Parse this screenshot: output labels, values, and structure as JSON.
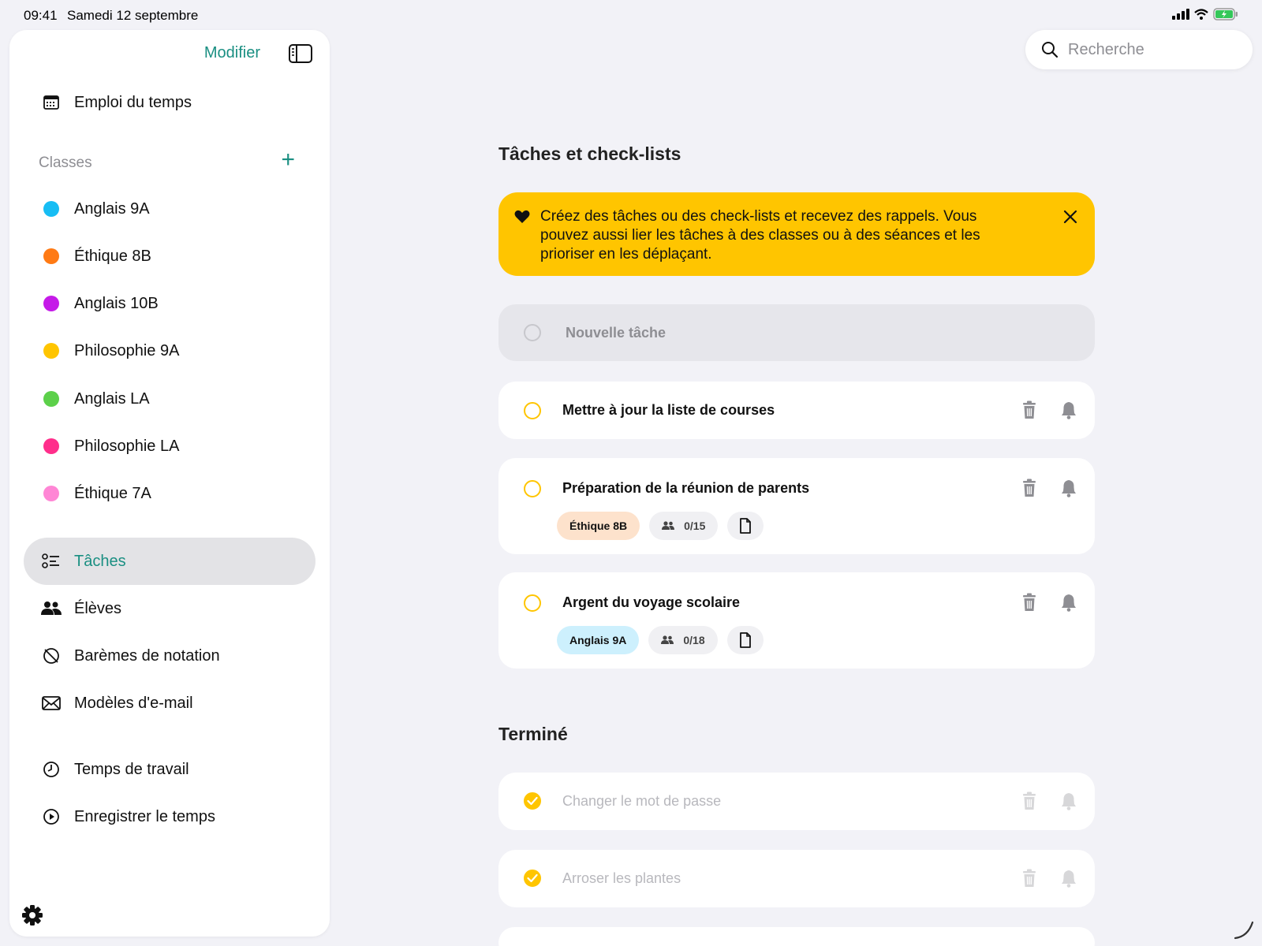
{
  "status_bar": {
    "time": "09:41",
    "date": "Samedi 12 septembre"
  },
  "sidebar": {
    "modify_label": "Modifier",
    "schedule_label": "Emploi du temps",
    "classes_header": "Classes",
    "classes_add": "+",
    "classes": [
      {
        "label": "Anglais 9A",
        "color": "#17bdf4"
      },
      {
        "label": "Éthique 8B",
        "color": "#ff7a14"
      },
      {
        "label": "Anglais 10B",
        "color": "#c51ae8"
      },
      {
        "label": "Philosophie 9A",
        "color": "#ffc500"
      },
      {
        "label": "Anglais LA",
        "color": "#5cd04a"
      },
      {
        "label": "Philosophie LA",
        "color": "#ff2e8b"
      },
      {
        "label": "Éthique 7A",
        "color": "#ff86d5"
      }
    ],
    "nav": [
      {
        "label": "Tâches",
        "icon": "checklist-icon",
        "selected": true
      },
      {
        "label": "Élèves",
        "icon": "people-icon"
      },
      {
        "label": "Barèmes de notation",
        "icon": "grading-icon"
      },
      {
        "label": "Modèles d'e-mail",
        "icon": "envelope-icon"
      }
    ],
    "time_items": [
      {
        "label": "Temps de travail",
        "icon": "clock-icon"
      },
      {
        "label": "Enregistrer le temps",
        "icon": "play-circle-icon"
      }
    ]
  },
  "search": {
    "placeholder": "Recherche"
  },
  "main": {
    "title": "Tâches et check-lists",
    "banner": {
      "text": "Créez des tâches ou des check-lists et recevez des rappels. Vous pouvez aussi lier les tâches à des classes ou à des séances et les prioriser en les déplaçant.",
      "color": "#ffc500"
    },
    "new_task_placeholder": "Nouvelle tâche",
    "tasks": [
      {
        "title": "Mettre à jour la liste de courses"
      },
      {
        "title": "Préparation de la réunion de parents",
        "class_chip": "Éthique 8B",
        "class_chip_color": "#fde2cc",
        "students": "0/15"
      },
      {
        "title": "Argent du voyage scolaire",
        "class_chip": "Anglais 9A",
        "class_chip_color": "#cdf0fd",
        "students": "0/18"
      }
    ],
    "done_title": "Terminé",
    "done_tasks": [
      {
        "title": "Changer le mot de passe"
      },
      {
        "title": "Arroser les plantes"
      }
    ]
  },
  "accent_color": "#1a8f82"
}
